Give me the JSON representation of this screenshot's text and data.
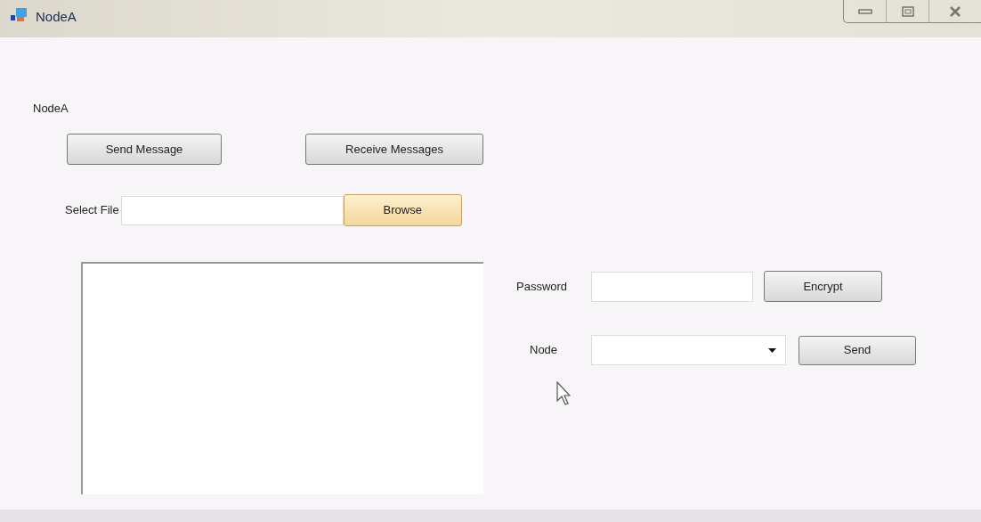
{
  "window": {
    "title": "NodeA"
  },
  "form_label": "NodeA",
  "top_buttons": [
    {
      "label": "Send Message"
    },
    {
      "label": "Receive Messages"
    }
  ],
  "file_row": {
    "label": "Select File",
    "browse_button": {
      "label": "Browse",
      "highlighted": true
    }
  },
  "password_row": {
    "label": "Password",
    "button": {
      "label": "Encrypt",
      "highlighted": false
    }
  },
  "node_row": {
    "label": "Node",
    "button": {
      "label": "Send",
      "highlighted": false
    }
  }
}
